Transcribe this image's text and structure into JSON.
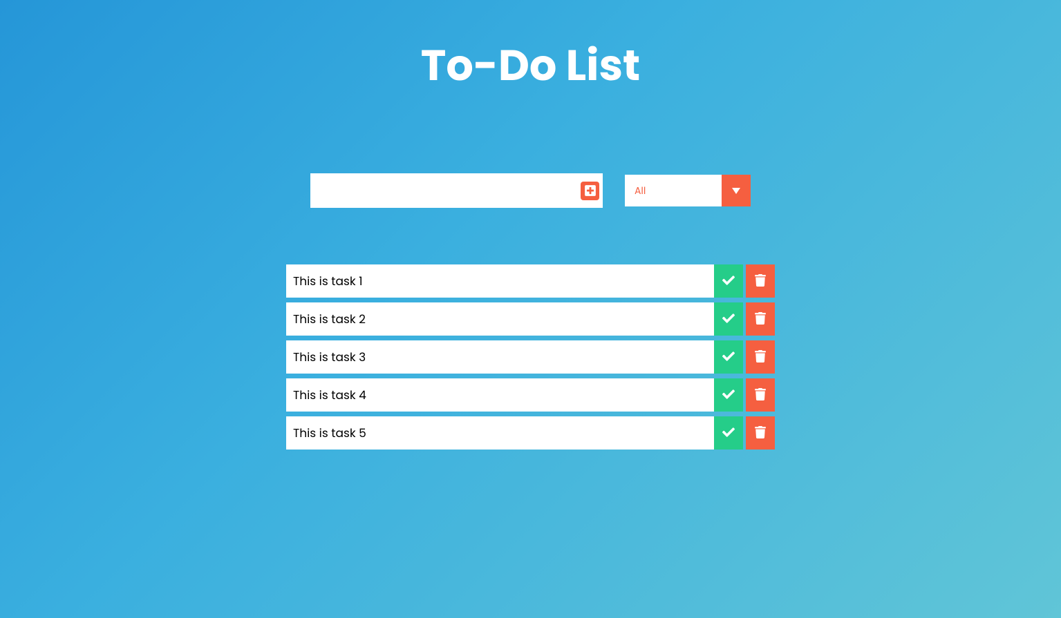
{
  "title": "To-Do List",
  "input": {
    "value": "",
    "placeholder": ""
  },
  "filter": {
    "selected": "All"
  },
  "tasks": [
    {
      "text": "This is task 1"
    },
    {
      "text": "This is task 2"
    },
    {
      "text": "This is task 3"
    },
    {
      "text": "This is task 4"
    },
    {
      "text": "This is task 5"
    }
  ],
  "colors": {
    "accent": "#f55f40",
    "success": "#25cd89"
  }
}
